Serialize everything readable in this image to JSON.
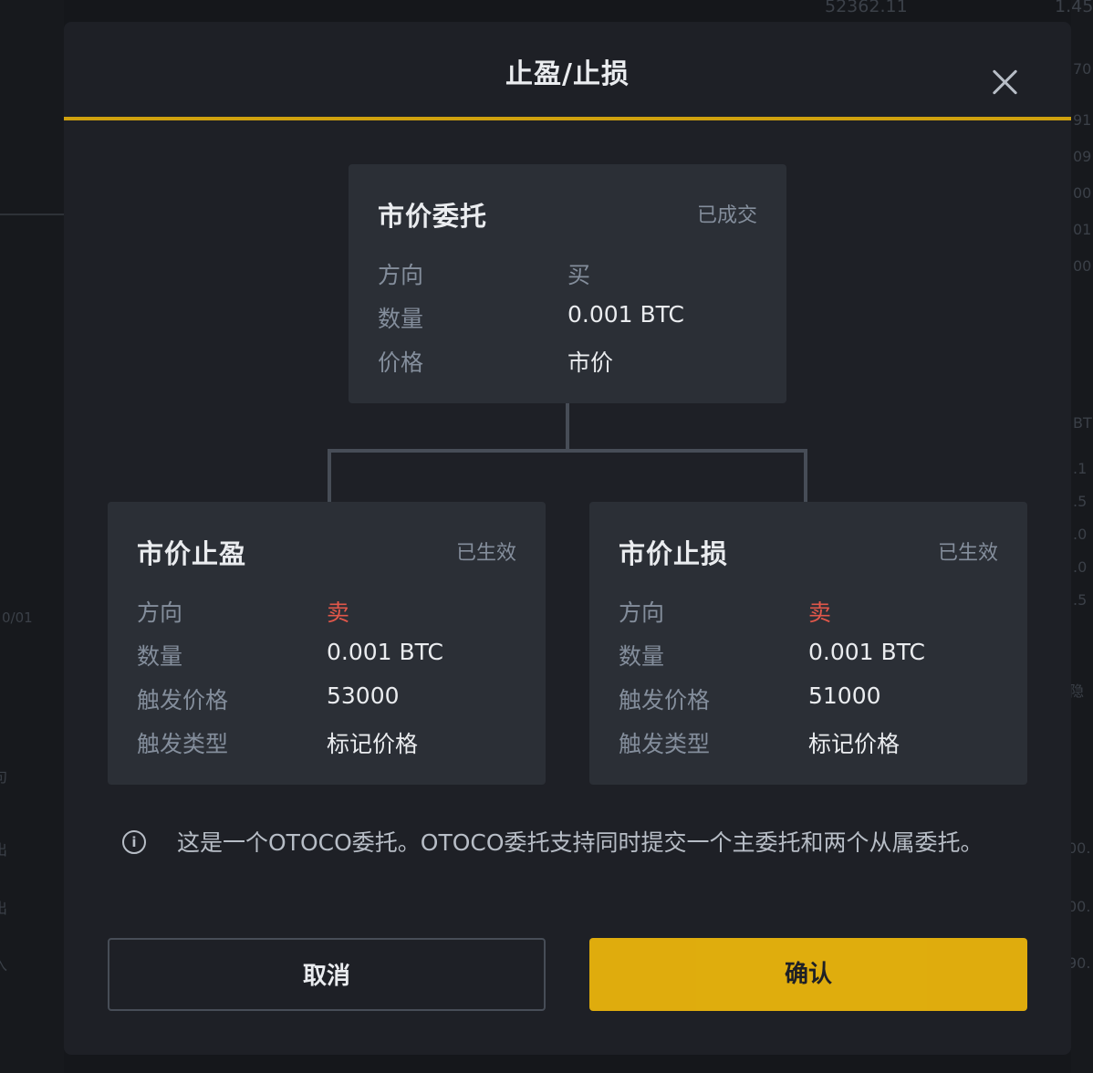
{
  "background": {
    "top_price": "52362.11",
    "top_right": "1.45",
    "date_label": "0/01",
    "right_fragments": [
      "70",
      "91",
      "09",
      "00",
      "01",
      "00",
      "BT",
      ".1",
      ".5",
      ".0",
      ".0",
      ".5",
      "隐",
      "00.",
      "00.",
      "90."
    ],
    "left_fragments": [
      "句",
      "出",
      "出",
      "入"
    ]
  },
  "modal": {
    "title": "止盈/止损",
    "close_icon": "close-icon"
  },
  "main_order": {
    "title": "市价委托",
    "status": "已成交",
    "rows": [
      {
        "label": "方向",
        "value": "买"
      },
      {
        "label": "数量",
        "value": "0.001 BTC"
      },
      {
        "label": "价格",
        "value": "市价"
      }
    ]
  },
  "take_profit": {
    "title": "市价止盈",
    "status": "已生效",
    "rows": [
      {
        "label": "方向",
        "value": "卖"
      },
      {
        "label": "数量",
        "value": "0.001 BTC"
      },
      {
        "label": "触发价格",
        "value": "53000"
      },
      {
        "label": "触发类型",
        "value": "标记价格"
      }
    ]
  },
  "stop_loss": {
    "title": "市价止损",
    "status": "已生效",
    "rows": [
      {
        "label": "方向",
        "value": "卖"
      },
      {
        "label": "数量",
        "value": "0.001 BTC"
      },
      {
        "label": "触发价格",
        "value": "51000"
      },
      {
        "label": "触发类型",
        "value": "标记价格"
      }
    ]
  },
  "info": {
    "icon": "info-icon",
    "text": "这是一个OTOCO委托。OTOCO委托支持同时提交一个主委托和两个从属委托。"
  },
  "buttons": {
    "cancel": "取消",
    "confirm": "确认"
  },
  "colors": {
    "accent": "#f0b90b",
    "sell": "#e1574a",
    "card_bg": "#2b2f36",
    "modal_bg": "#1e2026"
  }
}
